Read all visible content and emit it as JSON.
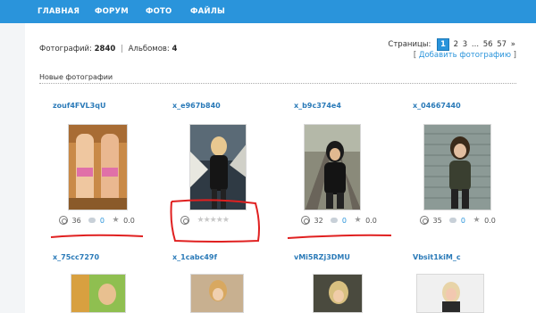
{
  "nav": {
    "items": [
      "ГЛАВНАЯ",
      "ФОРУМ",
      "ФОТО",
      "ФАЙЛЫ"
    ]
  },
  "stats": {
    "photos_label": "Фотографий:",
    "photos_count": "2840",
    "separator": "|",
    "albums_label": "Альбомов:",
    "albums_count": "4"
  },
  "pager": {
    "label": "Страницы:",
    "pages": [
      "1",
      "2",
      "3",
      "...",
      "56",
      "57",
      "»"
    ],
    "active": "1"
  },
  "add_photo": {
    "open": "[",
    "label": "Добавить фотографию",
    "close": "]"
  },
  "section_title": "Новые фотографии",
  "cards": [
    {
      "name": "zouf4FVL3qU",
      "views": "36",
      "comments": "0",
      "rating": "0.0",
      "photo_colors": [
        "#b77a3a",
        "#e8b890"
      ]
    },
    {
      "name": "x_e967b840",
      "rating_stars": "★★★★★",
      "photo_colors": [
        "#3c4650",
        "#d8d0c4"
      ]
    },
    {
      "name": "x_b9c374e4",
      "views": "32",
      "comments": "0",
      "rating": "0.0",
      "photo_colors": [
        "#6a6a5c",
        "#1a1a1a"
      ]
    },
    {
      "name": "x_04667440",
      "views": "35",
      "comments": "0",
      "rating": "0.0",
      "photo_colors": [
        "#7c8a86",
        "#2a3028"
      ]
    },
    {
      "name": "x_75cc7270",
      "photo_colors": [
        "#7ab23a",
        "#e0a040"
      ]
    },
    {
      "name": "x_1cabc49f",
      "photo_colors": [
        "#d9b88a",
        "#9a8a70"
      ]
    },
    {
      "name": "vMi5RZj3DMU",
      "photo_colors": [
        "#d4c28c",
        "#4a4a3a"
      ]
    },
    {
      "name": "Vbsit1kiM_c",
      "photo_colors": [
        "#e8e8e8",
        "#c9a48a"
      ]
    }
  ],
  "colors": {
    "nav_bg": "#2a94db",
    "link": "#2a7ab8",
    "annotation_red": "#e02020"
  }
}
